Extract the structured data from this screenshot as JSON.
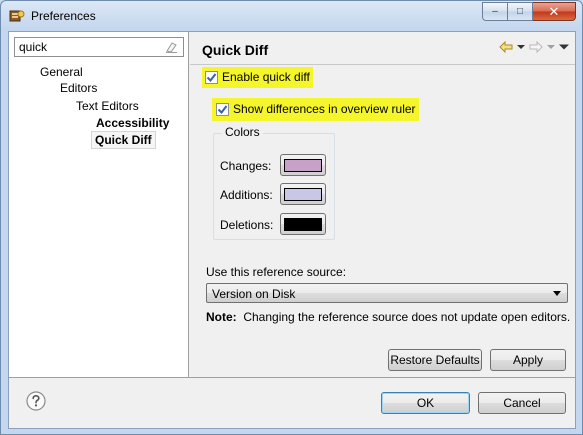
{
  "window": {
    "title": "Preferences"
  },
  "window_controls": {
    "minimize": "–",
    "maximize": "□",
    "close": "✕"
  },
  "filter": {
    "value": "quick"
  },
  "tree": [
    {
      "label": "General",
      "bold": false,
      "selected": false
    },
    {
      "label": "Editors",
      "bold": false,
      "selected": false
    },
    {
      "label": "Text Editors",
      "bold": false,
      "selected": false
    },
    {
      "label": "Accessibility",
      "bold": true,
      "selected": false
    },
    {
      "label": "Quick Diff",
      "bold": true,
      "selected": true
    }
  ],
  "page": {
    "title": "Quick Diff",
    "enable_quick_diff": {
      "label": "Enable quick diff",
      "checked": true
    },
    "show_differences": {
      "label": "Show differences in overview ruler",
      "checked": true
    },
    "colors": {
      "legend": "Colors",
      "changes": {
        "label": "Changes:",
        "color": "#c8a0c8"
      },
      "additions": {
        "label": "Additions:",
        "color": "#c8c8e6"
      },
      "deletions": {
        "label": "Deletions:",
        "color": "#000000"
      }
    },
    "reference_source": {
      "label": "Use this reference source:",
      "value": "Version on Disk"
    },
    "note": {
      "prefix": "Note:",
      "text": "Changing the reference source does not update open editors."
    },
    "restore_defaults": "Restore Defaults",
    "apply": "Apply"
  },
  "footer": {
    "ok": "OK",
    "cancel": "Cancel"
  },
  "icons": {
    "app": "eclipse-preferences-icon",
    "filter_clear": "eraser-icon",
    "back": "back-arrow-icon",
    "forward": "forward-arrow-icon",
    "menu": "view-menu-icon",
    "help": "help-icon"
  },
  "colors": {
    "highlight": "#f5f52c",
    "selection_border": "#d5d5d5"
  }
}
